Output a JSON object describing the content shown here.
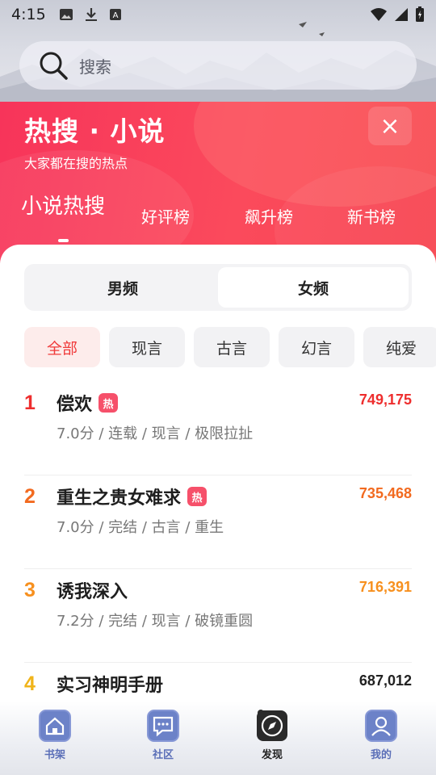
{
  "status_bar": {
    "time": "4:15"
  },
  "search": {
    "placeholder": "搜索"
  },
  "hot": {
    "title": "热搜 · 小说",
    "subtitle": "大家都在搜的热点",
    "close": "×",
    "tabs": [
      {
        "label": "小说热搜",
        "active": true
      },
      {
        "label": "好评榜"
      },
      {
        "label": "飙升榜"
      },
      {
        "label": "新书榜"
      }
    ]
  },
  "gender": {
    "male": "男频",
    "female": "女频",
    "selected": "女频"
  },
  "chips": [
    "全部",
    "现言",
    "古言",
    "幻言",
    "纯爱"
  ],
  "ranking": [
    {
      "rank": "1",
      "title": "偿欢",
      "hot": "热",
      "meta": "7.0分 / 连载 / 现言 / 极限拉扯",
      "score": "749,175",
      "color": "#ee2e2e"
    },
    {
      "rank": "2",
      "title": "重生之贵女难求",
      "hot": "热",
      "meta": "7.0分 / 完结 / 古言 / 重生",
      "score": "735,468",
      "color": "#f26a1f"
    },
    {
      "rank": "3",
      "title": "诱我深入",
      "meta": "7.2分 / 完结 / 现言 / 破镜重圆",
      "score": "716,391",
      "color": "#f7901e"
    },
    {
      "rank": "4",
      "title": "实习神明手册",
      "meta": "",
      "score": "687,012",
      "color": "#222222",
      "rank_color": "#f0b41a"
    }
  ],
  "nav": [
    {
      "label": "书架",
      "icon": "bookshelf-icon"
    },
    {
      "label": "社区",
      "icon": "community-icon"
    },
    {
      "label": "发现",
      "icon": "discover-icon",
      "active": true
    },
    {
      "label": "我的",
      "icon": "profile-icon"
    }
  ],
  "colors": {
    "accent": "#f7345a",
    "nav_blue": "#5b6fb8"
  }
}
